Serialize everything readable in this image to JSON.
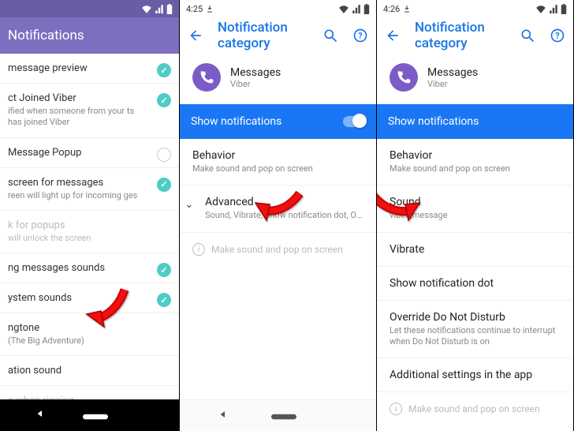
{
  "panel1": {
    "status": {
      "time": ""
    },
    "appbar_title": "Notifications",
    "rows": [
      {
        "title": "message preview",
        "sub": "",
        "state": "on"
      },
      {
        "title": "ct Joined Viber",
        "sub": "ified when someone from your ts has joined Viber",
        "state": "on"
      },
      {
        "title": "Message Popup",
        "sub": "",
        "state": "off"
      },
      {
        "title": "screen for messages",
        "sub": "reen will light up for incoming ges",
        "state": "on"
      },
      {
        "title": "k for popups",
        "sub": "will unlock the screen",
        "state": "disabled"
      },
      {
        "title": "ng messages sounds",
        "sub": "",
        "state": "on"
      },
      {
        "title": "ystem sounds",
        "sub": "",
        "state": "on"
      },
      {
        "title": "ngtone",
        "sub": "(The Big Adventure)",
        "state": "none"
      },
      {
        "title": "ation sound",
        "sub": "",
        "state": "none"
      },
      {
        "title": "e when ringing",
        "sub": "",
        "state": "disabled"
      }
    ]
  },
  "panel2": {
    "status": {
      "time": "4:25"
    },
    "appbar_title": "Notification category",
    "app": {
      "name": "Messages",
      "publisher": "Viber"
    },
    "show_notifications": "Show notifications",
    "rows": [
      {
        "title": "Behavior",
        "sub": "Make sound and pop on screen"
      },
      {
        "title": "Advanced",
        "sub": "Sound, Vibrate, Show notification dot, Override..",
        "expandable": true
      }
    ],
    "info_text": "Make sound and pop on screen"
  },
  "panel3": {
    "status": {
      "time": "4:26"
    },
    "appbar_title": "Notification category",
    "app": {
      "name": "Messages",
      "publisher": "Viber"
    },
    "show_notifications": "Show notifications",
    "rows": [
      {
        "title": "Behavior",
        "sub": "Make sound and pop on screen"
      },
      {
        "title": "Sound",
        "sub": "viber_message"
      },
      {
        "title": "Vibrate",
        "sub": ""
      },
      {
        "title": "Show notification dot",
        "sub": ""
      },
      {
        "title": "Override Do Not Disturb",
        "sub": "Let these notifications continue to interrupt when Do Not Disturb is on"
      },
      {
        "title": "Additional settings in the app",
        "sub": ""
      }
    ],
    "info_text": "Make sound and pop on screen"
  },
  "colors": {
    "viber_purple": "#7c6fc0",
    "blue": "#1976f5",
    "teal_check": "#4ecdc4",
    "arrow_red": "#e40b0b"
  }
}
